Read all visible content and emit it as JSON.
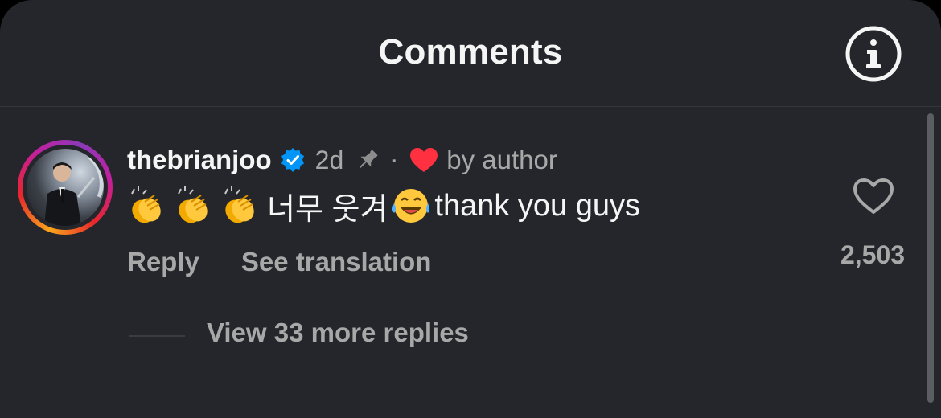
{
  "header": {
    "title": "Comments",
    "info_icon": "info-circle-icon"
  },
  "comment": {
    "username": "thebrianjoo",
    "verified_icon": "verified-badge-icon",
    "time": "2d",
    "pinned_icon": "pin-icon",
    "separator": "·",
    "liked_by_author_icon": "red-heart-icon",
    "liked_by_author_text": "by author",
    "text_korean": "너무 웃겨",
    "text_english": "thank you guys",
    "emojis": [
      "clapping-hands-emoji",
      "clapping-hands-emoji",
      "clapping-hands-emoji",
      "tears-of-joy-emoji"
    ],
    "reply_label": "Reply",
    "translate_label": "See translation",
    "like_icon": "heart-outline-icon",
    "like_count": "2,503",
    "view_replies_label": "View 33 more replies"
  },
  "colors": {
    "background": "#24262b",
    "primary_text": "#f5f5f5",
    "secondary_text": "#a8a8a8",
    "verified_blue": "#0095f6",
    "heart_red": "#ff3040"
  }
}
